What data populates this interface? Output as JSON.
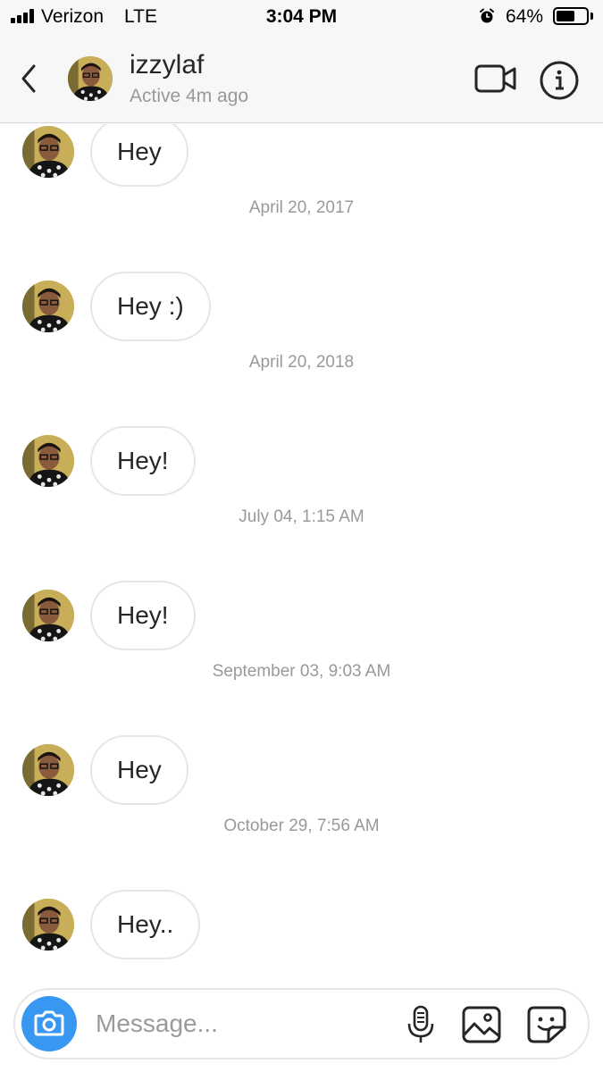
{
  "status_bar": {
    "carrier": "Verizon",
    "network": "LTE",
    "time": "3:04 PM",
    "battery_percent": "64%",
    "battery_level": 0.64
  },
  "header": {
    "username": "izzylaf",
    "active_status": "Active 4m ago"
  },
  "messages": [
    {
      "text": "Hey"
    },
    {
      "date": "April 20, 2017",
      "text": "Hey :)"
    },
    {
      "date": "April 20, 2018",
      "text": "Hey!"
    },
    {
      "date": "July 04, 1:15 AM",
      "text": "Hey!"
    },
    {
      "date": "September 03, 9:03 AM",
      "text": "Hey"
    },
    {
      "date": "October 29, 7:56 AM",
      "text": "Hey.."
    }
  ],
  "composer": {
    "placeholder": "Message..."
  },
  "colors": {
    "accent": "#3897f0",
    "bubble_border": "#e6e6e6",
    "muted_text": "#999999"
  }
}
